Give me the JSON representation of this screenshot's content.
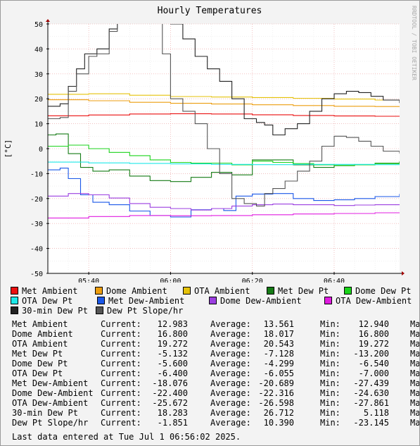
{
  "chart_data": {
    "type": "line",
    "title": "Hourly Temperatures",
    "ylabel": "[°C]",
    "watermark": "RRDTOOL / TOBI OETIKER",
    "ylim": [
      -50,
      50
    ],
    "yticks": [
      50,
      40,
      30,
      20,
      10,
      0,
      -10,
      -20,
      -30,
      -40,
      -50
    ],
    "xlim": [
      "05:30",
      "06:56"
    ],
    "xticks": [
      "05:40",
      "06:00",
      "06:20",
      "06:40"
    ],
    "grid": true,
    "legend_position": "bottom",
    "series": [
      {
        "name": "Met Ambient",
        "color": "#ea0f0f",
        "x": [
          "05:30",
          "05:40",
          "05:50",
          "06:00",
          "06:10",
          "06:20",
          "06:30",
          "06:40",
          "06:50",
          "06:56"
        ],
        "y": [
          13.2,
          13.5,
          13.9,
          14.0,
          13.9,
          13.6,
          13.3,
          13.1,
          13.0,
          13.0
        ]
      },
      {
        "name": "Dome Ambient",
        "color": "#ec9d0f",
        "x": [
          "05:30",
          "05:40",
          "05:50",
          "06:00",
          "06:10",
          "06:20",
          "06:30",
          "06:40",
          "06:50",
          "06:56"
        ],
        "y": [
          19.6,
          19.2,
          18.6,
          18.2,
          17.9,
          17.6,
          17.3,
          17.0,
          16.9,
          16.8
        ]
      },
      {
        "name": "OTA Ambient",
        "color": "#e5c20a",
        "x": [
          "05:30",
          "05:40",
          "05:50",
          "06:00",
          "06:10",
          "06:20",
          "06:30",
          "06:40",
          "06:50",
          "06:56"
        ],
        "y": [
          21.8,
          22.0,
          21.4,
          20.9,
          20.7,
          20.5,
          20.2,
          19.9,
          19.5,
          19.3
        ]
      },
      {
        "name": "Met Dew Pt",
        "color": "#157b15",
        "x": [
          "05:30",
          "05:32",
          "05:35",
          "05:38",
          "05:41",
          "05:45",
          "05:50",
          "05:55",
          "06:00",
          "06:05",
          "06:10",
          "06:15",
          "06:20",
          "06:25",
          "06:30",
          "06:35",
          "06:40",
          "06:45",
          "06:50",
          "06:56"
        ],
        "y": [
          5.5,
          5.9,
          -2.0,
          -7.5,
          -9.0,
          -8.5,
          -11.0,
          -12.8,
          -13.2,
          -11.5,
          -9.5,
          -10.5,
          -4.5,
          -4.5,
          -6.5,
          -7.5,
          -6.8,
          -6.5,
          -5.8,
          -5.1
        ]
      },
      {
        "name": "Dome Dew Pt",
        "color": "#1bd31b",
        "x": [
          "05:30",
          "05:35",
          "05:40",
          "05:45",
          "05:50",
          "05:55",
          "06:00",
          "06:05",
          "06:10",
          "06:15",
          "06:20",
          "06:25",
          "06:30",
          "06:35",
          "06:40",
          "06:45",
          "06:50",
          "06:56"
        ],
        "y": [
          1.0,
          1.4,
          0.0,
          -1.5,
          -2.8,
          -4.5,
          -5.5,
          -5.8,
          -5.8,
          -6.5,
          -5.0,
          -5.5,
          -6.0,
          -6.5,
          -6.7,
          -6.5,
          -6.0,
          -5.6
        ]
      },
      {
        "name": "OTA Dew Pt",
        "color": "#1ce8e8",
        "x": [
          "05:30",
          "05:40",
          "05:50",
          "06:00",
          "06:10",
          "06:20",
          "06:30",
          "06:40",
          "06:50",
          "06:56"
        ],
        "y": [
          -5.4,
          -5.7,
          -5.9,
          -6.1,
          -6.3,
          -6.4,
          -6.3,
          -6.3,
          -6.4,
          -6.4
        ]
      },
      {
        "name": "Met Dew-Ambient",
        "color": "#1a57e8",
        "x": [
          "05:30",
          "05:33",
          "05:35",
          "05:38",
          "05:41",
          "05:45",
          "05:50",
          "05:55",
          "06:00",
          "06:05",
          "06:10",
          "06:13",
          "06:16",
          "06:20",
          "06:25",
          "06:30",
          "06:35",
          "06:40",
          "06:45",
          "06:50",
          "06:56"
        ],
        "y": [
          -8.5,
          -7.8,
          -12.0,
          -18.5,
          -21.5,
          -22.5,
          -25.0,
          -26.8,
          -27.4,
          -24.5,
          -24.0,
          -24.8,
          -19.0,
          -18.2,
          -18.0,
          -20.0,
          -20.8,
          -20.5,
          -20.0,
          -19.2,
          -18.1
        ]
      },
      {
        "name": "Dome Dew-Ambient",
        "color": "#9b3ee0",
        "x": [
          "05:30",
          "05:35",
          "05:40",
          "05:45",
          "05:50",
          "05:55",
          "06:00",
          "06:05",
          "06:10",
          "06:15",
          "06:20",
          "06:25",
          "06:30",
          "06:35",
          "06:40",
          "06:45",
          "06:50",
          "06:56"
        ],
        "y": [
          -19.0,
          -18.0,
          -18.5,
          -19.8,
          -22.0,
          -23.5,
          -24.0,
          -24.6,
          -24.0,
          -23.0,
          -22.5,
          -22.2,
          -22.5,
          -22.5,
          -22.8,
          -22.6,
          -22.5,
          -22.4
        ]
      },
      {
        "name": "OTA Dew-Ambient",
        "color": "#e01ce0",
        "x": [
          "05:30",
          "05:40",
          "05:50",
          "06:00",
          "06:10",
          "06:20",
          "06:30",
          "06:40",
          "06:50",
          "06:56"
        ],
        "y": [
          -27.8,
          -27.2,
          -26.8,
          -26.9,
          -26.8,
          -26.5,
          -26.2,
          -26.0,
          -25.7,
          -25.7
        ]
      },
      {
        "name": "30-min Dew Pt",
        "color": "#222222",
        "x": [
          "05:30",
          "05:33",
          "05:35",
          "05:37",
          "05:39",
          "05:42",
          "05:45",
          "05:47",
          "05:49",
          "05:52",
          "05:55",
          "05:58",
          "06:00",
          "06:03",
          "06:06",
          "06:09",
          "06:12",
          "06:15",
          "06:18",
          "06:21",
          "06:23",
          "06:25",
          "06:28",
          "06:31",
          "06:34",
          "06:37",
          "06:40",
          "06:43",
          "06:46",
          "06:49",
          "06:52",
          "06:56"
        ],
        "y": [
          17.0,
          18.0,
          25.0,
          32.0,
          38.0,
          40.0,
          48.0,
          52.0,
          55.0,
          60.0,
          62.0,
          60.0,
          50.0,
          44.0,
          37.0,
          32.0,
          27.0,
          20.0,
          12.0,
          10.5,
          9.5,
          5.5,
          8.0,
          10.0,
          15.0,
          20.0,
          22.0,
          23.0,
          22.5,
          21.0,
          19.5,
          18.3
        ]
      },
      {
        "name": "Dew Pt Slope/hr",
        "color": "#555555",
        "x": [
          "05:30",
          "05:33",
          "05:35",
          "05:37",
          "05:40",
          "05:42",
          "05:45",
          "05:47",
          "05:49",
          "05:52",
          "05:55",
          "05:58",
          "06:00",
          "06:03",
          "06:06",
          "06:09",
          "06:12",
          "06:15",
          "06:18",
          "06:21",
          "06:23",
          "06:25",
          "06:28",
          "06:31",
          "06:34",
          "06:37",
          "06:40",
          "06:43",
          "06:46",
          "06:49",
          "06:52",
          "06:56"
        ],
        "y": [
          12.0,
          12.5,
          23.0,
          30.0,
          37.0,
          38.0,
          47.0,
          52.0,
          55.0,
          60.0,
          62.0,
          38.0,
          20.0,
          15.0,
          10.0,
          0.0,
          -10.0,
          -20.0,
          -22.0,
          -23.0,
          -18.0,
          -16.0,
          -13.0,
          -9.0,
          -5.0,
          1.0,
          5.0,
          4.5,
          3.0,
          1.0,
          -1.0,
          -1.9
        ]
      }
    ]
  },
  "legend": [
    {
      "label": "Met Ambient",
      "color": "#ea0f0f"
    },
    {
      "label": "Dome Ambient",
      "color": "#ec9d0f"
    },
    {
      "label": "OTA Ambient",
      "color": "#e5c20a"
    },
    {
      "label": "Met Dew Pt",
      "color": "#157b15"
    },
    {
      "label": "Dome Dew Pt",
      "color": "#1bd31b"
    },
    {
      "label": "OTA Dew Pt",
      "color": "#1ce8e8"
    },
    {
      "label": "Met Dew-Ambient",
      "color": "#1a57e8"
    },
    {
      "label": "Dome Dew-Ambient",
      "color": "#9b3ee0"
    },
    {
      "label": "OTA Dew-Ambient",
      "color": "#e01ce0"
    },
    {
      "label": "30-min Dew Pt",
      "color": "#222222"
    },
    {
      "label": "Dew Pt Slope/hr",
      "color": "#555555"
    }
  ],
  "stats_labels": {
    "current": "Current:",
    "average": "Average:",
    "min": "Min:",
    "max": "Ma"
  },
  "stats": [
    {
      "name": "Met Ambient",
      "current": "12.983",
      "average": "13.561",
      "min": "12.940"
    },
    {
      "name": "Dome Ambient",
      "current": "16.800",
      "average": "18.017",
      "min": "16.800"
    },
    {
      "name": "OTA Ambient",
      "current": "19.272",
      "average": "20.543",
      "min": "19.272"
    },
    {
      "name": "Met Dew Pt",
      "current": "-5.132",
      "average": "-7.128",
      "min": "-13.200"
    },
    {
      "name": "Dome Dew Pt",
      "current": "-5.600",
      "average": "-4.299",
      "min": "-6.540"
    },
    {
      "name": "OTA Dew Pt",
      "current": "-6.400",
      "average": "-6.055",
      "min": "-7.000"
    },
    {
      "name": "Met Dew-Ambient",
      "current": "-18.076",
      "average": "-20.689",
      "min": "-27.439"
    },
    {
      "name": "Dome Dew-Ambient",
      "current": "-22.400",
      "average": "-22.316",
      "min": "-24.630"
    },
    {
      "name": "OTA Dew-Ambient",
      "current": "-25.672",
      "average": "-26.598",
      "min": "-27.861"
    },
    {
      "name": "30-min Dew Pt",
      "current": "18.283",
      "average": "26.712",
      "min": "5.118"
    },
    {
      "name": "Dew Pt Slope/hr",
      "current": "-1.851",
      "average": "10.390",
      "min": "-23.145"
    }
  ],
  "footer": "Last data entered at Tue Jul  1 06:56:02 2025."
}
